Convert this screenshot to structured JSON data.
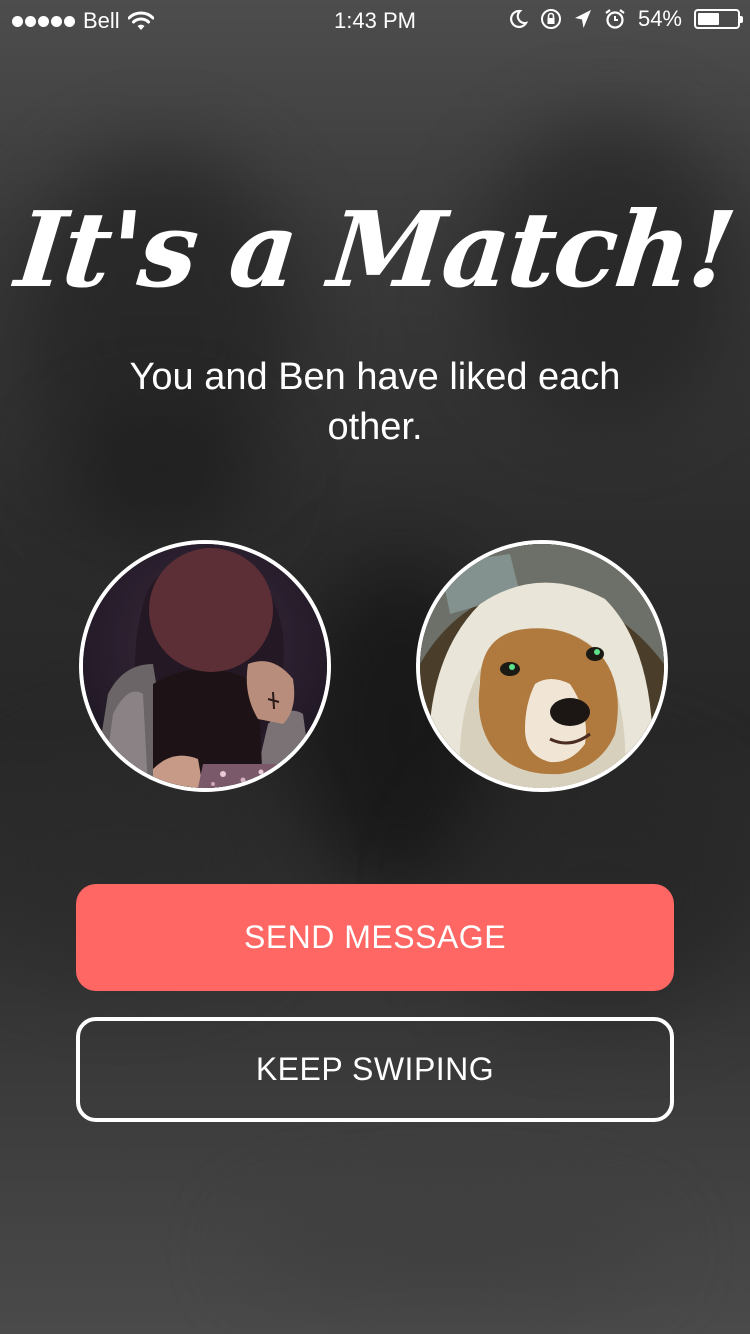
{
  "status_bar": {
    "carrier": "Bell",
    "time": "1:43 PM",
    "battery_percent": "54%",
    "battery_level": 0.54,
    "icons": [
      "signal-dots-icon",
      "wifi-icon",
      "moon-icon",
      "rotation-lock-icon",
      "location-arrow-icon",
      "alarm-icon",
      "battery-icon"
    ]
  },
  "match": {
    "title": "It's a Match!",
    "subtitle": "You and Ben have liked each other."
  },
  "avatars": {
    "user": "user-photo",
    "match": "dog-photo"
  },
  "actions": {
    "send_message_label": "SEND MESSAGE",
    "keep_swiping_label": "KEEP SWIPING"
  },
  "colors": {
    "accent": "#fe6763",
    "text": "#ffffff",
    "background": "#2c2c2c"
  }
}
